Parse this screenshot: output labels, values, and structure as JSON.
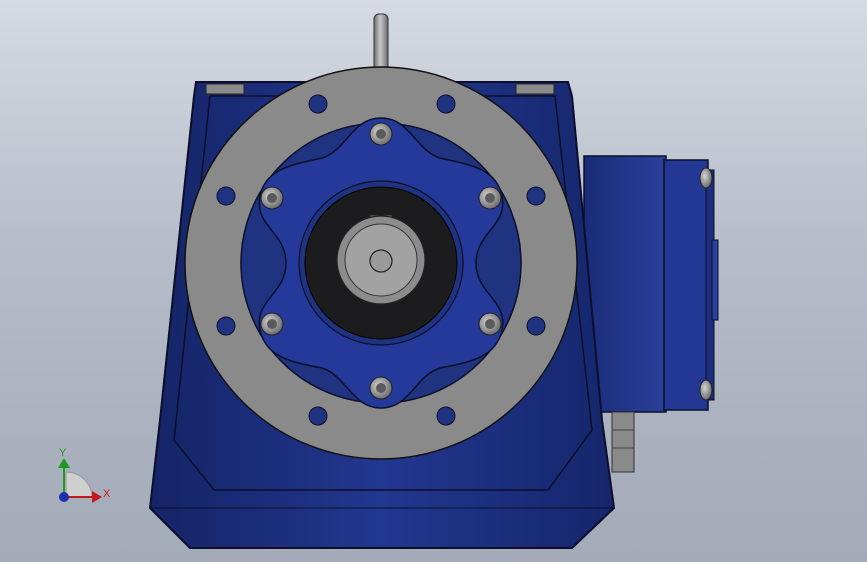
{
  "viewport": {
    "background_top": "#d5dae3",
    "background_bottom": "#a3aab8"
  },
  "model": {
    "body_color": "#1f3380",
    "flange_color": "#8a8a8a",
    "bore_color": "#1c1c1e",
    "bolt_color": "#9a9a9a"
  },
  "triad": {
    "x_label": "X",
    "y_label": "Y",
    "x_color": "#c21a1a",
    "y_color": "#1e9a1e",
    "z_color": "#1e2fb0"
  }
}
